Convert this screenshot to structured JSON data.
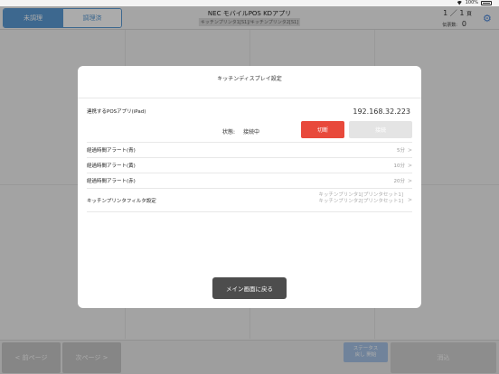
{
  "status_bar": {
    "battery": "100%"
  },
  "header": {
    "tabs": [
      {
        "label": "未調理",
        "active": true
      },
      {
        "label": "調理済",
        "active": false
      }
    ],
    "title": "NEC モバイルPOS KDアプリ",
    "subtitle": "キッチンプリンタ1[S1]/キッチンプリンタ2[S1]",
    "page_current": "1",
    "page_sep": "／",
    "page_total": "1",
    "page_unit": "頁",
    "slip_label": "伝票数:",
    "slip_count": "0",
    "settings_icon": "gear-icon"
  },
  "footer": {
    "prev_label": "< 前ページ",
    "next_label": "次ページ >",
    "status_undo_line1": "ステータス",
    "status_undo_line2": "戻し 開始",
    "erase_label": "消込"
  },
  "modal": {
    "title": "キッチンディスプレイ設定",
    "pos_app_label": "連携するPOSアプリ(iPad)",
    "pos_app_ip": "192.168.32.223",
    "state_label": "状態:",
    "state_value": "接続中",
    "disconnect_label": "切断",
    "connect_label": "接続",
    "alerts": [
      {
        "label": "経過時間アラート(青)",
        "value": "5分"
      },
      {
        "label": "経過時間アラート(黄)",
        "value": "10分"
      },
      {
        "label": "経過時間アラート(赤)",
        "value": "20分"
      }
    ],
    "filter_label": "キッチンプリンタフィルタ設定",
    "filter_value_1": "キッチンプリンタ1[プリンタセット1]",
    "filter_value_2": "キッチンプリンタ2[プリンタセット1]",
    "chevron": ">",
    "back_label": "メイン画面に戻る"
  },
  "colors": {
    "accent": "#5b9bd5",
    "disconnect": "#e8493b",
    "back_button": "#4d4d4d"
  }
}
